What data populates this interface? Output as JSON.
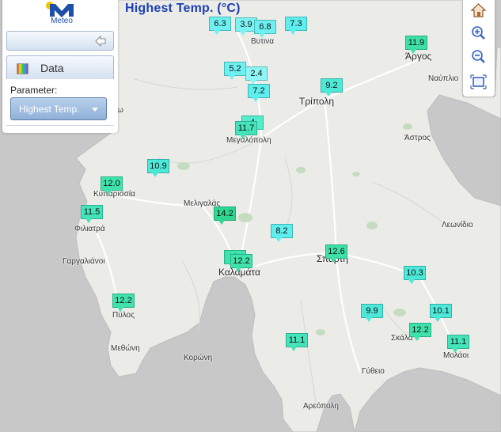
{
  "title": "Highest Temp. (°C)",
  "brand": {
    "name": "Meteo"
  },
  "panel": {
    "data_tab": "Data",
    "parameter_label": "Parameter:",
    "parameter_value": "Highest Temp."
  },
  "colors": {
    "sea": "#c9c9c9",
    "land": "#ececea",
    "marker_cyan": "#6ef0f0",
    "marker_green": "#3de0a6",
    "accent": "#1d3fb3"
  },
  "toolbar": {
    "tools": [
      {
        "name": "home-icon"
      },
      {
        "name": "zoom-in-icon"
      },
      {
        "name": "zoom-out-icon"
      },
      {
        "name": "zoom-extent-icon"
      }
    ]
  },
  "markers": [
    {
      "value": "6.3"
    },
    {
      "value": "3.9"
    },
    {
      "value": "6.8"
    },
    {
      "value": "7.3"
    },
    {
      "value": "11.9"
    },
    {
      "value": "5.2"
    },
    {
      "value": "2.4"
    },
    {
      "value": "7.2"
    },
    {
      "value": "9.2"
    },
    {
      "value": "11.7"
    },
    {
      "value": "4"
    },
    {
      "value": "10.9"
    },
    {
      "value": "12.0"
    },
    {
      "value": "11.5"
    },
    {
      "value": "14.2"
    },
    {
      "value": "8.2"
    },
    {
      "value": "12.6"
    },
    {
      "value": "1"
    },
    {
      "value": "12.2"
    },
    {
      "value": "10.3"
    },
    {
      "value": "12.2"
    },
    {
      "value": "9.9"
    },
    {
      "value": "10.1"
    },
    {
      "value": "12.2"
    },
    {
      "value": "11.1"
    },
    {
      "value": "11.1"
    }
  ],
  "cities": [
    "Βυτινα",
    "Άργος",
    "Ναύπλιο",
    "Τρίπολη",
    "Μεγαλόπολη",
    "Άστρος",
    "Κυπαρισσία",
    "Μελιγαλάς",
    "Λεωνίδιο",
    "Φιλιατρά",
    "Γαργαλιάνοι",
    "Σπάρτη",
    "Καλαμάτα",
    "Πύλος",
    "Μεθώνη",
    "Κορώνη",
    "Σκάλα",
    "Μολάοι",
    "Γύθειο",
    "Αρεόπολη",
    "ω"
  ]
}
